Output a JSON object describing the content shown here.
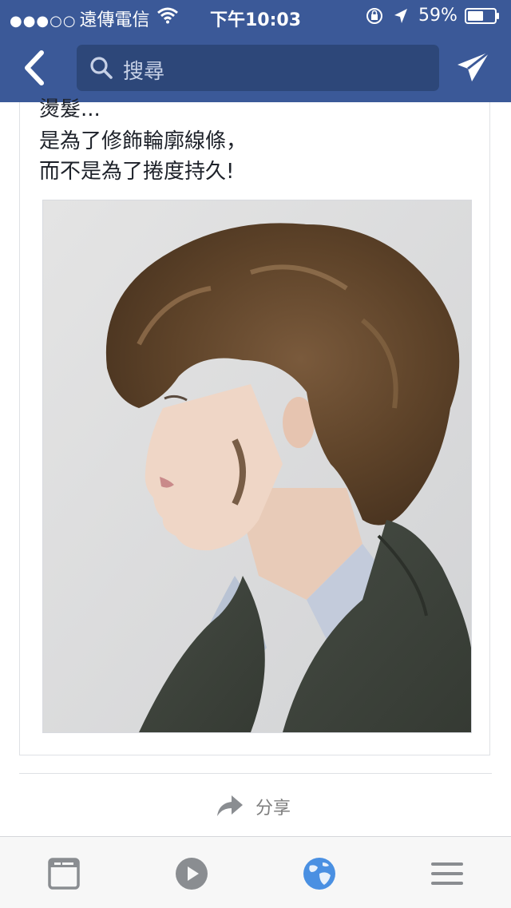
{
  "status_bar": {
    "signal_dots": "●●●○○",
    "carrier": "遠傳電信",
    "time": "下午10:03",
    "battery_percent": "59%",
    "battery_level": 0.59,
    "icons": [
      "wifi-icon",
      "rotation-lock-icon",
      "location-arrow-icon",
      "battery-icon"
    ]
  },
  "nav": {
    "back_icon": "chevron-left-icon",
    "search_placeholder": "搜尋",
    "send_icon": "paper-plane-icon"
  },
  "post": {
    "text_lines": [
      "燙髮...",
      "是為了修飾輪廓線條，",
      "而不是為了捲度持久!"
    ],
    "photo": "photo-short-curly-hair-profile"
  },
  "share": {
    "label": "分享",
    "icon": "share-arrow-icon"
  },
  "tabbar": {
    "items": [
      "news-feed-icon",
      "video-play-icon",
      "globe-icon",
      "menu-icon"
    ],
    "active_color": "#4a90e2"
  },
  "colors": {
    "brand": "#3b5998",
    "search_bg": "#2d4779",
    "tab_icon": "#8a8d91"
  }
}
